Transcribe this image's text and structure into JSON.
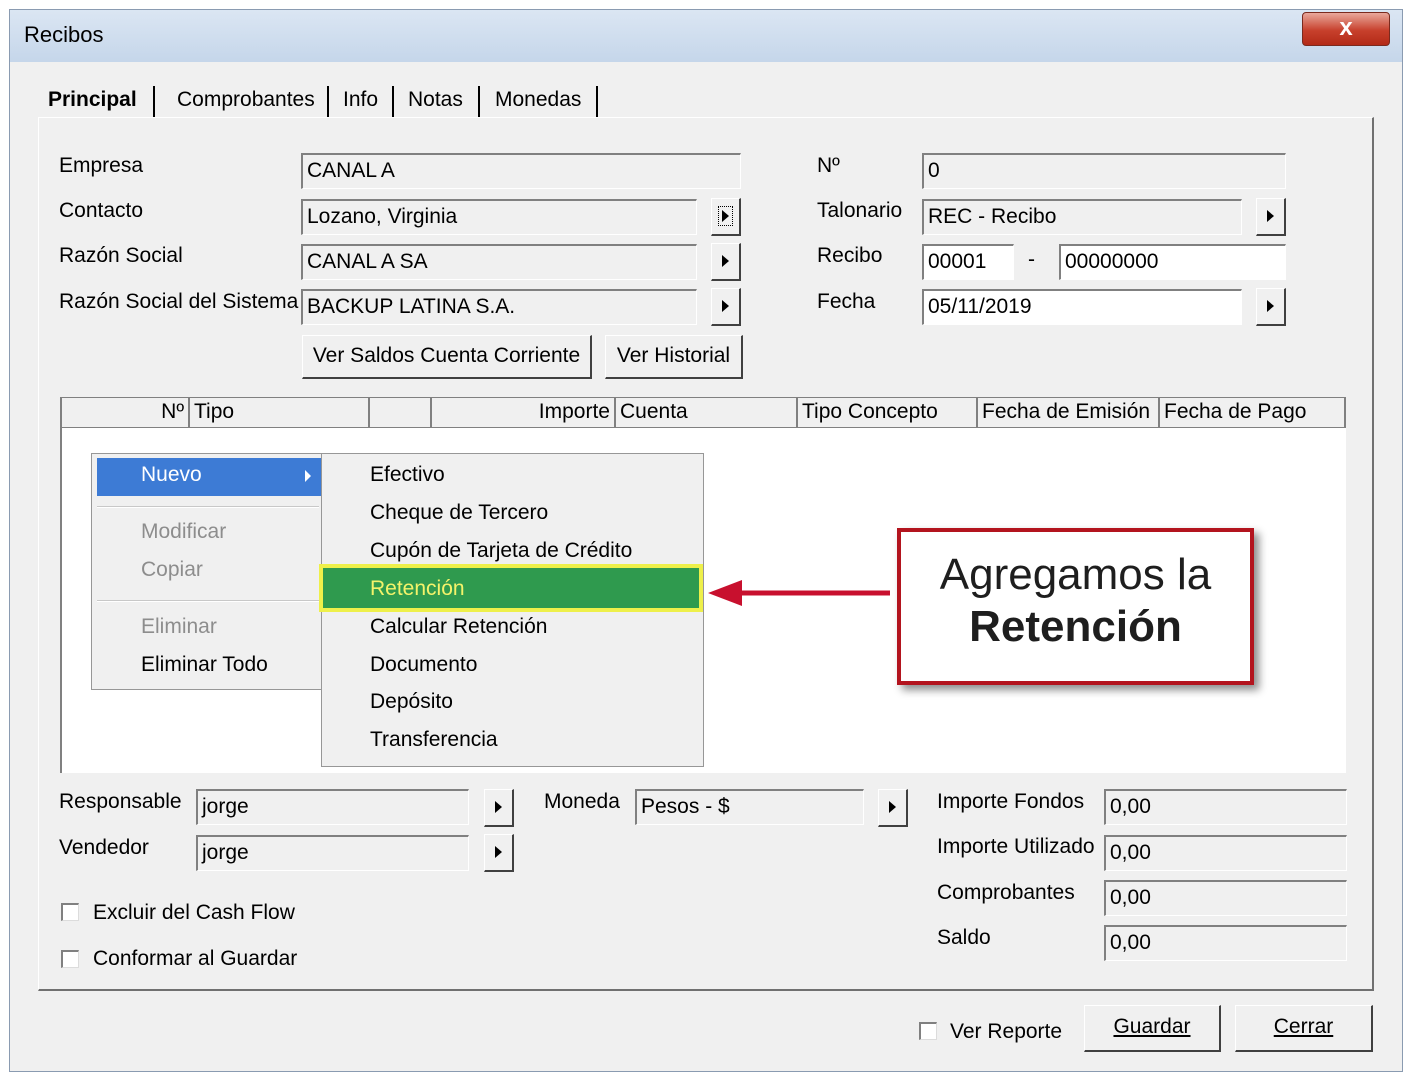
{
  "window": {
    "title": "Recibos",
    "close_label": "x"
  },
  "tabs": [
    {
      "label": "Principal",
      "active": true
    },
    {
      "label": "Comprobantes"
    },
    {
      "label": "Info"
    },
    {
      "label": "Notas"
    },
    {
      "label": "Monedas"
    }
  ],
  "header_left": {
    "empresa_label": "Empresa",
    "empresa_value": "CANAL A",
    "contacto_label": "Contacto",
    "contacto_value": "Lozano, Virginia",
    "razon_social_label": "Razón Social",
    "razon_social_value": "CANAL A SA",
    "razon_sistema_label": "Razón Social del Sistema",
    "razon_sistema_value": "BACKUP LATINA S.A.",
    "ver_saldos_button": "Ver Saldos Cuenta Corriente",
    "ver_historial_button": "Ver Historial"
  },
  "header_right": {
    "numero_label": "Nº",
    "numero_value": "0",
    "talonario_label": "Talonario",
    "talonario_value": "REC - Recibo",
    "recibo_label": "Recibo",
    "recibo_prefix": "00001",
    "recibo_dash": "-",
    "recibo_number": "00000000",
    "fecha_label": "Fecha",
    "fecha_value": "05/11/2019"
  },
  "grid": {
    "columns": [
      "Nº",
      "Tipo",
      "",
      "Importe",
      "Cuenta",
      "Tipo Concepto",
      "Fecha de Emisión",
      "Fecha de Pago"
    ]
  },
  "context_menu": {
    "items": [
      {
        "label": "Nuevo",
        "highlighted": true,
        "has_submenu": true
      },
      {
        "label": "Modificar",
        "disabled": true
      },
      {
        "label": "Copiar",
        "disabled": true
      },
      {
        "label": "Eliminar",
        "disabled": true
      },
      {
        "label": "Eliminar Todo"
      }
    ],
    "submenu": [
      {
        "label": "Efectivo"
      },
      {
        "label": "Cheque de Tercero"
      },
      {
        "label": "Cupón de Tarjeta de Crédito"
      },
      {
        "label": "Retención",
        "highlighted": true
      },
      {
        "label": "Calcular Retención"
      },
      {
        "label": "Documento"
      },
      {
        "label": "Depósito"
      },
      {
        "label": "Transferencia"
      }
    ]
  },
  "callout": {
    "line1": "Agregamos la",
    "line2": "Retención",
    "border_color": "#b3141e",
    "arrow_color": "#c8102e"
  },
  "footer_left": {
    "responsable_label": "Responsable",
    "responsable_value": "jorge",
    "vendedor_label": "Vendedor",
    "vendedor_value": "jorge",
    "moneda_label": "Moneda",
    "moneda_value": "Pesos - $",
    "excluir_label": "Excluir del Cash Flow",
    "conformar_label": "Conformar al Guardar"
  },
  "footer_right": {
    "importe_fondos_label": "Importe Fondos",
    "importe_fondos_value": "0,00",
    "importe_utilizado_label": "Importe Utilizado",
    "importe_utilizado_value": "0,00",
    "comprobantes_label": "Comprobantes",
    "comprobantes_value": "0,00",
    "saldo_label": "Saldo",
    "saldo_value": "0,00"
  },
  "bottom": {
    "ver_reporte_label": "Ver Reporte",
    "guardar_button": "Guardar",
    "cerrar_button": "Cerrar"
  },
  "colors": {
    "menu_highlight": "#3d7bd5",
    "retencion_highlight": "#2f9a4e",
    "retencion_outline": "#eef04a"
  }
}
